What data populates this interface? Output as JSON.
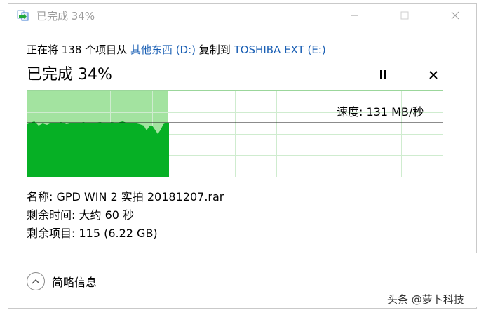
{
  "window": {
    "title": "已完成 34%",
    "icon": "copy-arrow-icon"
  },
  "header": {
    "prefix": "正在将 138 个项目从 ",
    "source": "其他东西 (D:)",
    "middle": " 复制到 ",
    "destination": "TOSHIBA EXT (E:)"
  },
  "progress": {
    "label": "已完成 34%",
    "fraction": 0.34
  },
  "speed": {
    "label": "速度: 131 MB/秒"
  },
  "details": {
    "name": "名称: GPD WIN 2 实拍 20181207.rar",
    "time_remaining": "剩余时间: 大约 60 秒",
    "items_remaining": "剩余项目: 115 (6.22 GB)"
  },
  "footer": {
    "more_label": "简略信息"
  },
  "watermark": "头条 @萝卜科技",
  "colors": {
    "progress_fill": "#a3e3a0",
    "graph_fill": "#06b025",
    "grid": "#cfeccf",
    "link": "#1a5fb4"
  }
}
